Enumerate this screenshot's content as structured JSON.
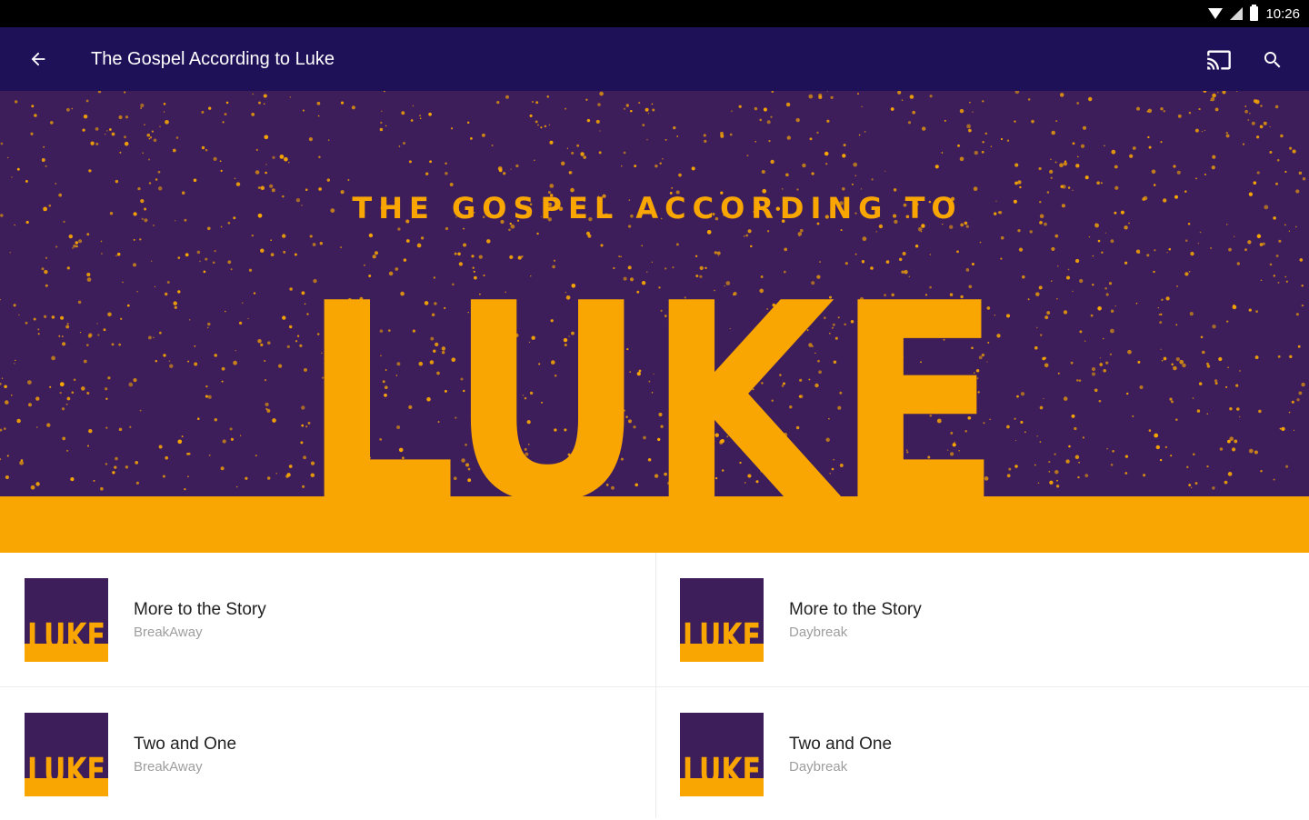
{
  "status_bar": {
    "time": "10:26"
  },
  "app_bar": {
    "title": "The Gospel According to Luke"
  },
  "hero": {
    "subtitle": "THE GOSPEL ACCORDING TO",
    "word": "LUKE",
    "colors": {
      "background": "#3d1d5a",
      "accent": "#f9a602"
    }
  },
  "items": [
    {
      "title": "More to the Story",
      "subtitle": "BreakAway",
      "thumb_word": "LUKE"
    },
    {
      "title": "More to the Story",
      "subtitle": "Daybreak",
      "thumb_word": "LUKE"
    },
    {
      "title": "Two and One",
      "subtitle": "BreakAway",
      "thumb_word": "LUKE"
    },
    {
      "title": "Two and One",
      "subtitle": "Daybreak",
      "thumb_word": "LUKE"
    }
  ],
  "colors": {
    "app_bar": "#1e1158",
    "status_bar": "#000000",
    "primary_text": "#212121",
    "secondary_text": "#9e9e9e"
  }
}
